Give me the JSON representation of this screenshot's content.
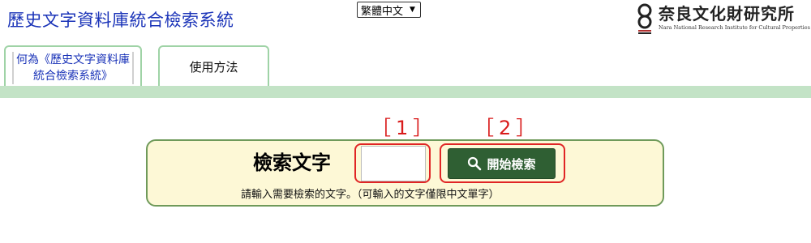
{
  "header": {
    "title": "歷史文字資料庫統合檢索系統",
    "language_select": {
      "selected": "繁體中文"
    },
    "logo": {
      "name": "奈良文化財研究所",
      "subtitle": "Nara National Research Institute for Cultural Properties"
    }
  },
  "tabs": [
    {
      "label_line1": "何為《歷史文字資料庫",
      "label_line2": "統合檢索系統》"
    },
    {
      "label": "使用方法"
    }
  ],
  "annotations": {
    "step1": "［1］",
    "step2": "［2］"
  },
  "search": {
    "label": "檢索文字",
    "input_value": "",
    "button_label": "開始檢索",
    "hint": "請輸入需要檢索的文字。（可輸入的文字僅限中文單字）"
  },
  "colors": {
    "title_blue": "#1a33b8",
    "tab_border": "#9fd3a6",
    "band_green": "#c3e3c6",
    "search_panel_bg": "#fdf8d6",
    "search_panel_border": "#6f9a5a",
    "button_green": "#2f5f33",
    "annotation_red": "#d91b1b"
  }
}
